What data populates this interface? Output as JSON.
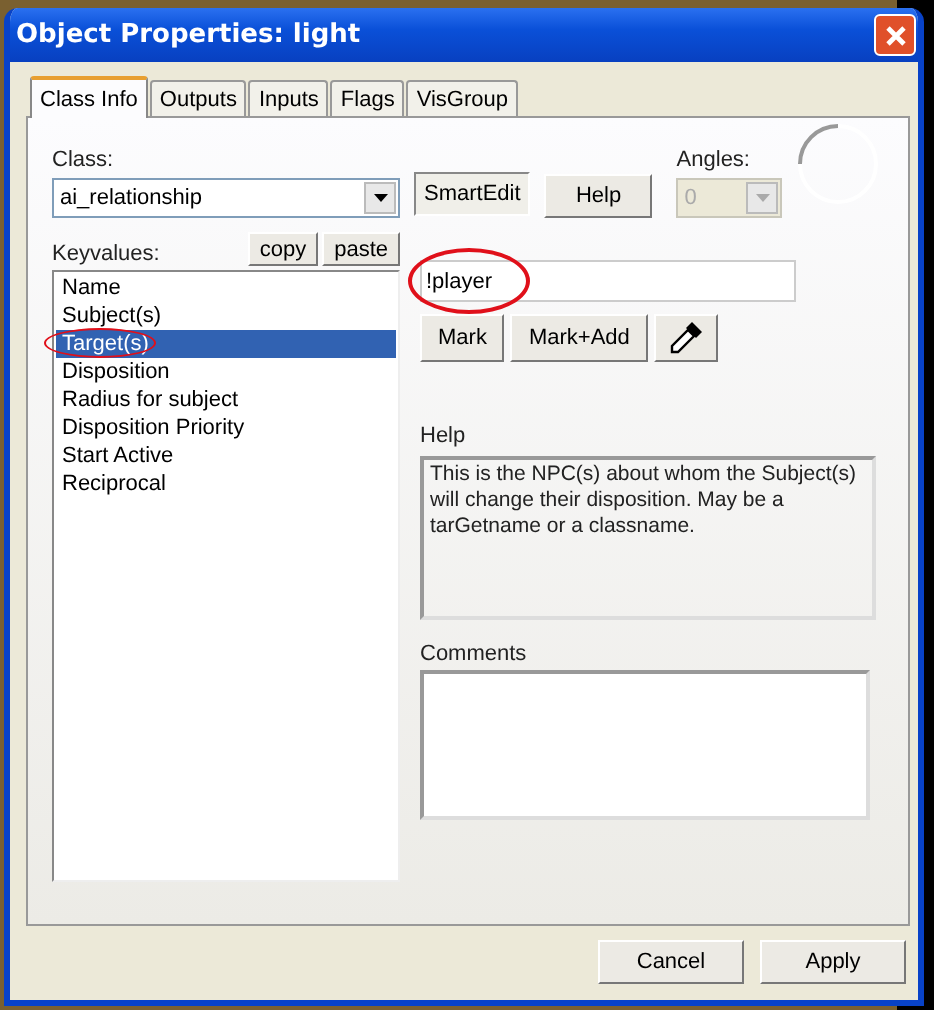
{
  "window": {
    "title": "Object Properties: light"
  },
  "tabs": [
    {
      "label": "Class Info",
      "selected": true
    },
    {
      "label": "Outputs",
      "selected": false
    },
    {
      "label": "Inputs",
      "selected": false
    },
    {
      "label": "Flags",
      "selected": false
    },
    {
      "label": "VisGroup",
      "selected": false
    }
  ],
  "class": {
    "label": "Class:",
    "value": "ai_relationship"
  },
  "smartedit": {
    "label": "SmartEdit",
    "pressed": true
  },
  "help_button": "Help",
  "angles": {
    "label": "Angles:",
    "value": "0",
    "disabled": true
  },
  "keyvalues": {
    "label": "Keyvalues:",
    "copy": "copy",
    "paste": "paste",
    "items": [
      {
        "label": "Name",
        "selected": false,
        "circled": false
      },
      {
        "label": "Subject(s)",
        "selected": false,
        "circled": false
      },
      {
        "label": "Target(s)",
        "selected": true,
        "circled": true
      },
      {
        "label": "Disposition",
        "selected": false,
        "circled": false
      },
      {
        "label": "Radius for subject",
        "selected": false,
        "circled": false
      },
      {
        "label": "Disposition Priority",
        "selected": false,
        "circled": false
      },
      {
        "label": "Start Active",
        "selected": false,
        "circled": false
      },
      {
        "label": "Reciprocal",
        "selected": false,
        "circled": false
      }
    ]
  },
  "value_field": {
    "value": "!player",
    "circled": true
  },
  "mark_buttons": [
    "Mark",
    "Mark+Add"
  ],
  "help": {
    "label": "Help",
    "text": "This is the NPC(s) about whom the Subject(s) will change their disposition. May be a tarGetname or a classname."
  },
  "comments": {
    "label": "Comments"
  },
  "footer_buttons": [
    "Cancel",
    "Apply"
  ]
}
